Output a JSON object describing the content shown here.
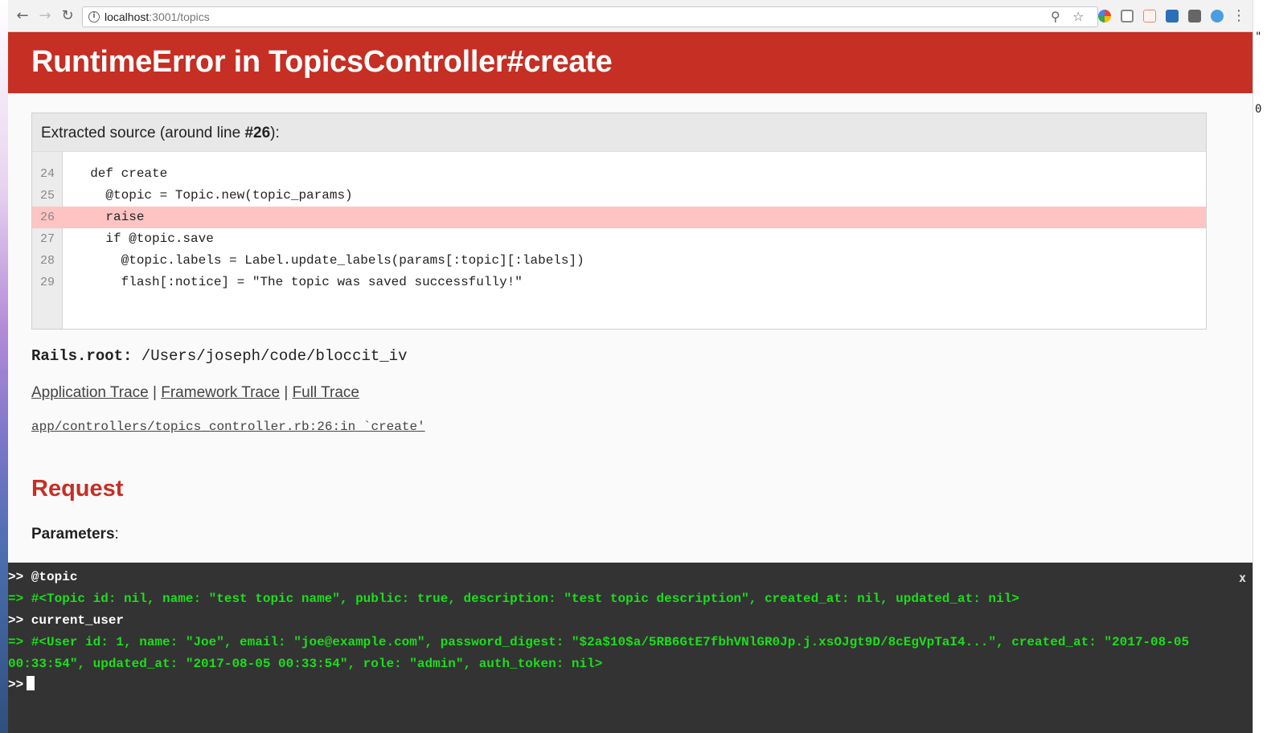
{
  "browser": {
    "url_host": "localhost",
    "url_path": ":3001/topics"
  },
  "error": {
    "title": "RuntimeError in TopicsController#create"
  },
  "source": {
    "header_prefix": "Extracted source (around line ",
    "header_line": "#26",
    "header_suffix": "):",
    "lines": [
      {
        "num": "24",
        "code": "  def create",
        "highlight": false
      },
      {
        "num": "25",
        "code": "    @topic = Topic.new(topic_params)",
        "highlight": false
      },
      {
        "num": "26",
        "code": "    raise",
        "highlight": true
      },
      {
        "num": "27",
        "code": "    if @topic.save",
        "highlight": false
      },
      {
        "num": "28",
        "code": "      @topic.labels = Label.update_labels(params[:topic][:labels])",
        "highlight": false
      },
      {
        "num": "29",
        "code": "      flash[:notice] = \"The topic was saved successfully!\"",
        "highlight": false
      }
    ]
  },
  "rails_root": {
    "label": "Rails.root:",
    "path": "/Users/joseph/code/bloccit_iv"
  },
  "traces": {
    "application": "Application Trace",
    "framework": "Framework Trace",
    "full": "Full Trace",
    "separator": " | ",
    "line": "app/controllers/topics_controller.rb:26:in `create'"
  },
  "request": {
    "title": "Request",
    "params_label": "Parameters",
    "params_suffix": ":"
  },
  "console": {
    "close": "x",
    "lines": [
      {
        "type": "cmd",
        "text": ">> @topic"
      },
      {
        "type": "out",
        "text": "=> #<Topic id: nil, name: \"test topic name\", public: true, description: \"test topic description\", created_at: nil, updated_at: nil>"
      },
      {
        "type": "cmd",
        "text": ">> current_user"
      },
      {
        "type": "out",
        "text": "=> #<User id: 1, name: \"Joe\", email: \"joe@example.com\", password_digest: \"$2a$10$a/5RB6GtE7fbhVNlGR0Jp.j.xsOJgt9D/8cEgVpTaI4...\", created_at: \"2017-08-05 00:33:54\", updated_at: \"2017-08-05 00:33:54\", role: \"admin\", auth_token: nil>"
      }
    ],
    "prompt": ">>"
  },
  "colors": {
    "error_red": "#c52f24",
    "highlight": "#fec4c4",
    "console_bg": "#333333",
    "console_output": "#1adf1a"
  }
}
